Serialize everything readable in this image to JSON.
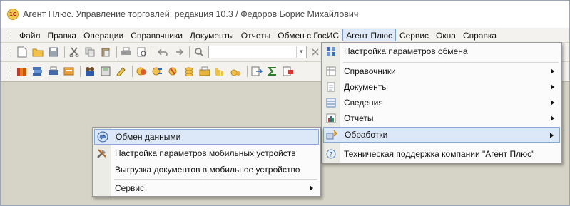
{
  "window": {
    "app_icon_text": "1C",
    "title": "Агент Плюс. Управление торговлей, редакция 10.3 / Федоров Борис Михайлович"
  },
  "menubar": {
    "items": [
      "Файл",
      "Правка",
      "Операции",
      "Справочники",
      "Документы",
      "Отчеты",
      "Обмен с ГосИС",
      "Агент Плюс",
      "Сервис",
      "Окна",
      "Справка"
    ],
    "active_index": 7
  },
  "toolbar": {
    "search_value": ""
  },
  "agent_menu": {
    "items": [
      {
        "label": "Настройка параметров обмена",
        "icon": "settings-grid-icon",
        "submenu": false
      },
      {
        "label": "Справочники",
        "icon": "catalog-icon",
        "submenu": true
      },
      {
        "label": "Документы",
        "icon": "document-icon",
        "submenu": true
      },
      {
        "label": "Сведения",
        "icon": "info-table-icon",
        "submenu": true
      },
      {
        "label": "Отчеты",
        "icon": "report-chart-icon",
        "submenu": true
      },
      {
        "label": "Обработки",
        "icon": "processing-icon",
        "submenu": true,
        "highlighted": true
      },
      {
        "label": "Техническая поддержка компании \"Агент Плюс\"",
        "icon": "help-icon",
        "submenu": false
      }
    ]
  },
  "processing_submenu": {
    "items": [
      {
        "label": "Обмен данными",
        "icon": "exchange-icon",
        "highlighted": true
      },
      {
        "label": "Настройка параметров мобильных устройств",
        "icon": "tools-icon"
      },
      {
        "label": "Выгрузка документов в мобильное устройство",
        "icon": ""
      },
      {
        "label": "Сервис",
        "icon": "",
        "submenu": true
      }
    ]
  },
  "colors": {
    "workspace": "#d6d3c7",
    "menu_highlight": "#dce8f7",
    "menu_highlight_border": "#89a9d6"
  }
}
